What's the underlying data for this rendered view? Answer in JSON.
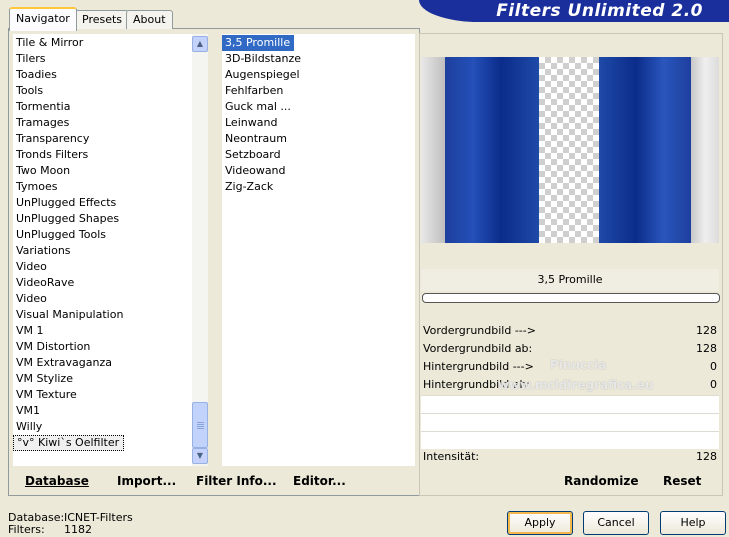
{
  "app": {
    "title": "Filters Unlimited 2.0"
  },
  "tabs": [
    {
      "label": "Navigator",
      "active": true
    },
    {
      "label": "Presets",
      "active": false
    },
    {
      "label": "About",
      "active": false
    }
  ],
  "categories": [
    "Tile & Mirror",
    "Tilers",
    "Toadies",
    "Tools",
    "Tormentia",
    "Tramages",
    "Transparency",
    "Tronds Filters",
    "Two Moon",
    "Tymoes",
    "UnPlugged Effects",
    "UnPlugged Shapes",
    "UnPlugged Tools",
    "Variations",
    "Video",
    "VideoRave",
    "Video",
    "Visual Manipulation",
    "VM 1",
    "VM Distortion",
    "VM Extravaganza",
    "VM Stylize",
    "VM Texture",
    "VM1",
    "Willy",
    "°v° Kiwi`s Oelfilter"
  ],
  "filters": [
    "3,5 Promille",
    "3D-Bildstanze",
    "Augenspiegel",
    "Fehlfarben",
    "Guck mal ...",
    "Leinwand",
    "Neontraum",
    "Setzboard",
    "Videowand",
    "Zig-Zack"
  ],
  "bottom_buttons": {
    "database": "Database",
    "import": "Import...",
    "filter_info": "Filter Info...",
    "editor": "Editor..."
  },
  "preview": {
    "filter_name": "3,5 Promille",
    "progress": 0
  },
  "watermark": {
    "line1": "Pinuccia",
    "line2": "www.mcldiregrafica.eu"
  },
  "params": [
    {
      "label": "Vordergrundbild --->",
      "value": "128"
    },
    {
      "label": "Vordergrundbild ab:",
      "value": "128"
    },
    {
      "label": "Hintergrundbild --->",
      "value": "0"
    },
    {
      "label": "Hintergrundbild ab:",
      "value": "0"
    },
    {
      "label": "Intensität:",
      "value": "128"
    }
  ],
  "actions": {
    "randomize": "Randomize",
    "reset": "Reset"
  },
  "status": {
    "database_label": "Database:",
    "database_value": "ICNET-Filters",
    "filters_label": "Filters:",
    "filters_value": "1182"
  },
  "dialog_buttons": {
    "apply": "Apply",
    "cancel": "Cancel",
    "help": "Help"
  },
  "colors": {
    "accent": "#316ac5",
    "banner": "#1a2f9c",
    "preview_blue": "#1f4aa8"
  }
}
